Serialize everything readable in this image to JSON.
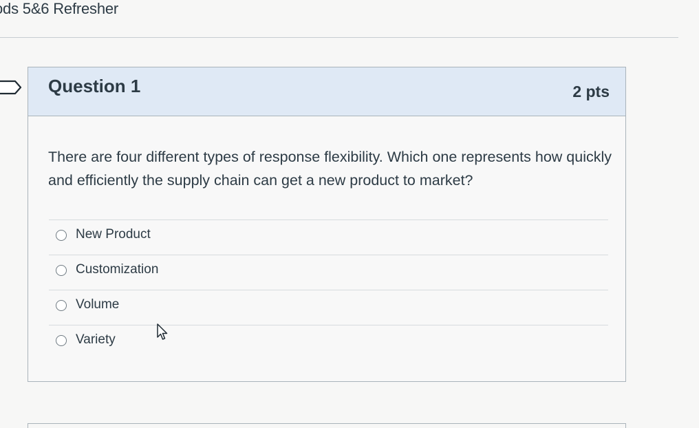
{
  "page": {
    "title": "ods 5&6 Refresher"
  },
  "question": {
    "name": "Question 1",
    "points": "2 pts",
    "text": "There are four different types of response flexibility. Which one represents how quickly and efficiently the supply chain can get a new product to market?",
    "answers": [
      {
        "label": "New Product",
        "selected": false
      },
      {
        "label": "Customization",
        "selected": false
      },
      {
        "label": "Volume",
        "selected": false
      },
      {
        "label": "Variety",
        "selected": false
      }
    ]
  },
  "icons": {
    "current_question_marker": "chevron-right-flag-icon",
    "mouse_cursor": "arrow-pointer-icon"
  },
  "colors": {
    "header_background": "#dfe9f5",
    "border": "#a9b3ba",
    "text": "#2d3b45",
    "page_background": "#f7f7f6"
  }
}
